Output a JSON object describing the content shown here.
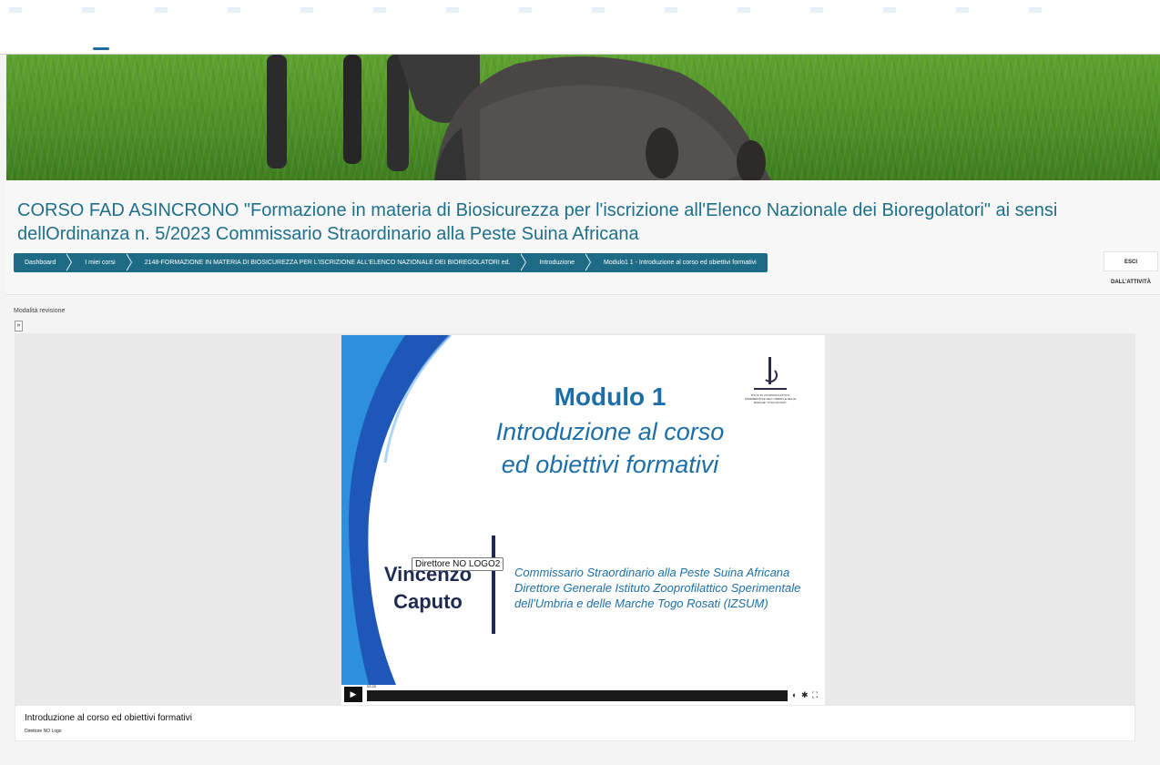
{
  "course": {
    "title": "CORSO FAD ASINCRONO \"Formazione in materia di Biosicurezza per l'iscrizione all'Elenco Nazionale dei Bioregolatori\" ai sensi dellOrdinanza n. 5/2023 Commissario Straordinario alla Peste Suina Africana"
  },
  "breadcrumb": [
    {
      "label": "Dashboard"
    },
    {
      "label": "I miei corsi"
    },
    {
      "label": "2148-FORMAZIONE IN MATERIA DI BIOSICUREZZA PER L'ISCRIZIONE ALL'ELENCO NAZIONALE DEI BIOREGOLATORI ed."
    },
    {
      "label": "Introduzione"
    },
    {
      "label": "Modulo1 1 - Introduzione al corso ed obiettivi formativi"
    }
  ],
  "exit_button": "ESCI DALL'ATTIVITÀ",
  "mode_label": "Modalità revisione",
  "toggle_symbol": "»",
  "slide": {
    "title": "Modulo 1",
    "subtitle_line1": "Introduzione al corso",
    "subtitle_line2": "ed obiettivi formativi",
    "speaker_first": "Vincenzo",
    "speaker_last": "Caputo",
    "role_line1": "Commissario Straordinario alla Peste Suina Africana",
    "role_line2": "Direttore Generale Istituto Zooprofilattico Sperimentale",
    "role_line3": "dell'Umbria e delle Marche Togo Rosati (IZSUM)",
    "logo_text": "ISTITUTO ZOOPROFILATTICO SPERIMENTALE DELL'UMBRIA E DELLE MARCHE \"TOGO ROSATI\"",
    "tooltip": "Direttore NO LOGO2"
  },
  "player": {
    "timecode": "03:20",
    "progress": 0.0,
    "play_icon": "play-icon",
    "volume_icon": "volume-icon",
    "settings_icon": "gear-icon",
    "fullscreen_icon": "fullscreen-icon"
  },
  "caption": {
    "title": "Introduzione al corso ed obiettivi formativi",
    "author": "Direttore NO Logo"
  }
}
